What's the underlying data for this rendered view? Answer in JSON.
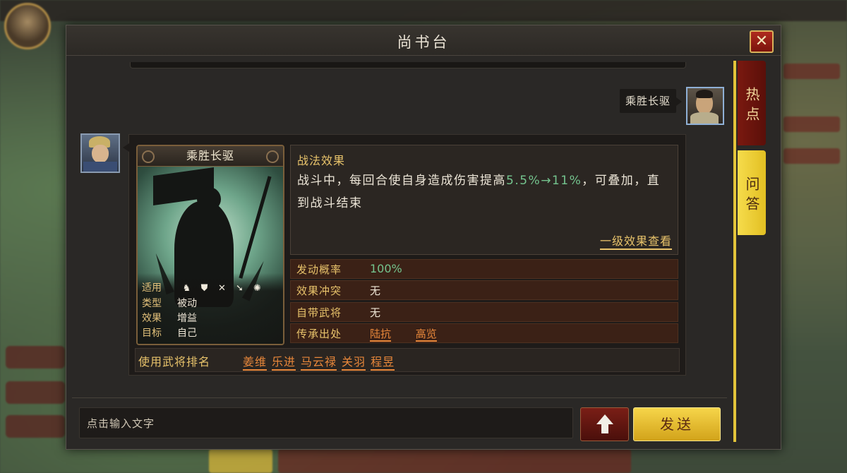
{
  "dialog": {
    "title": "尚书台",
    "close_label": "✕"
  },
  "chat": {
    "user_message": "乘胜长驱",
    "input_placeholder": "点击输入文字",
    "send_label": "发送"
  },
  "tabs": {
    "hot": "热点",
    "qa": "问答"
  },
  "skill": {
    "name": "乘胜长驱",
    "info": {
      "applicable_label": "适用",
      "type_label": "类型",
      "type_value": "被动",
      "effect_label": "效果",
      "effect_value": "增益",
      "target_label": "目标",
      "target_value": "自己",
      "troop_icons": [
        "cavalry-icon",
        "shield-icon",
        "bow-icon",
        "spear-icon",
        "siege-icon"
      ]
    },
    "effect": {
      "title": "战法效果",
      "text_before": "战斗中，每回合使自身造成伤害提高",
      "text_highlight": "5.5%→11%",
      "text_after": "，可叠加，直到战斗结束",
      "link": "一级效果查看"
    },
    "props": {
      "trigger_label": "发动概率",
      "trigger_value": "100%",
      "conflict_label": "效果冲突",
      "conflict_value": "无",
      "builtin_label": "自带武将",
      "builtin_value": "无",
      "inherit_label": "传承出处",
      "inherit_sources": [
        "陆抗",
        "高览"
      ]
    },
    "ranking": {
      "label": "使用武将排名",
      "generals": [
        "姜维",
        "乐进",
        "马云禄",
        "关羽",
        "程昱"
      ]
    }
  },
  "colors": {
    "accent_gold": "#e8c36b",
    "link_orange": "#e8873a",
    "highlight_green": "#74c48e",
    "send_yellow": "#f6d54a"
  }
}
